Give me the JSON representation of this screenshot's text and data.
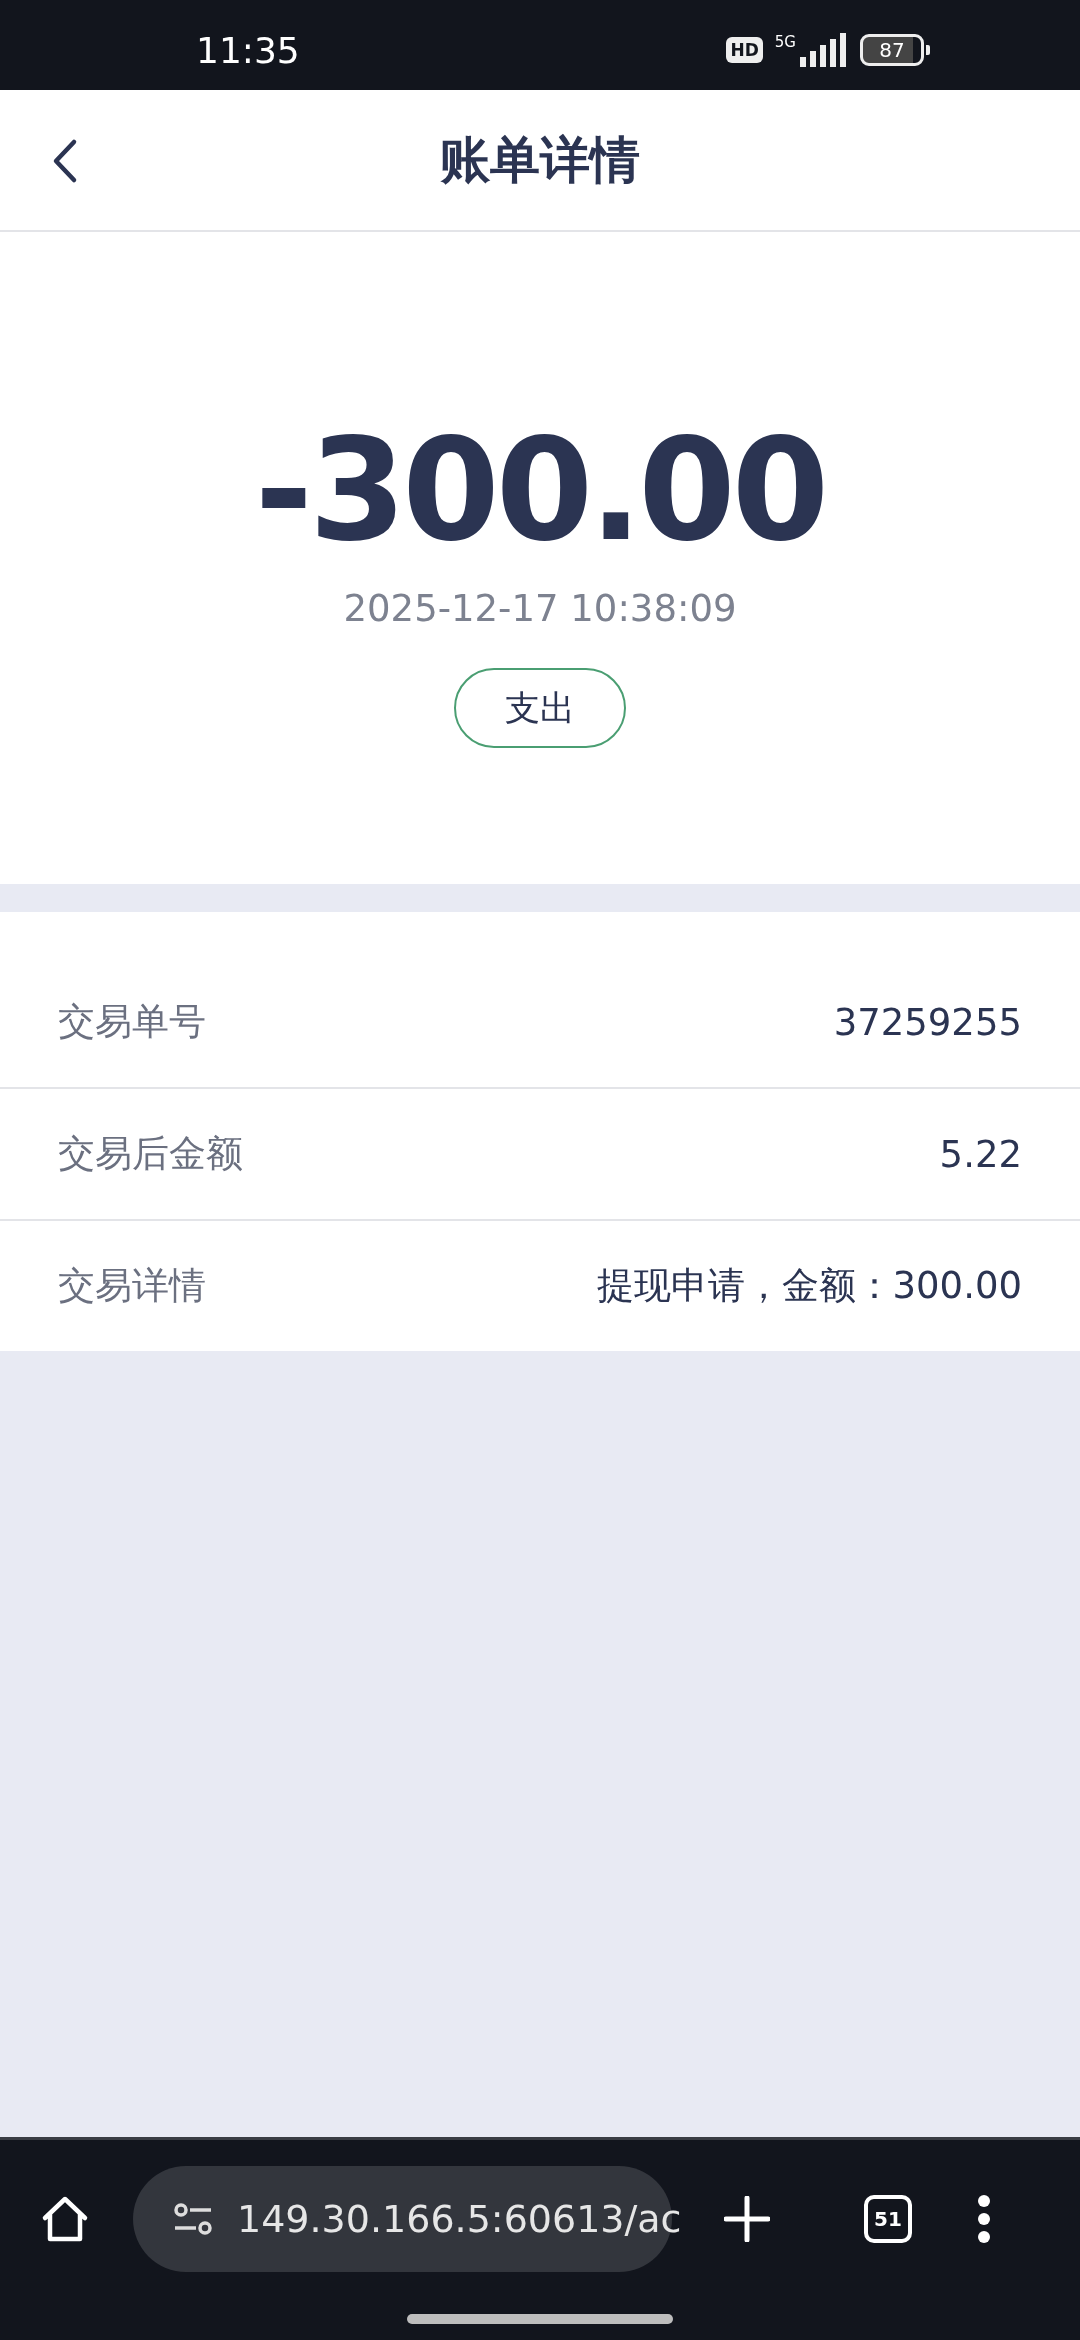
{
  "status_bar": {
    "time": "11:35",
    "hd_badge": "HD",
    "network": "5G",
    "battery": "87"
  },
  "header": {
    "title": "账单详情"
  },
  "summary": {
    "amount": "-300.00",
    "datetime": "2025-12-17 10:38:09",
    "type_tag": "支出"
  },
  "details": [
    {
      "label": "交易单号",
      "value": "37259255"
    },
    {
      "label": "交易后金额",
      "value": "5.22"
    },
    {
      "label": "交易详情",
      "value": "提现申请，金额：300.00"
    }
  ],
  "browser_bar": {
    "url": "149.30.166.5:60613/ac",
    "tab_count": "51"
  }
}
